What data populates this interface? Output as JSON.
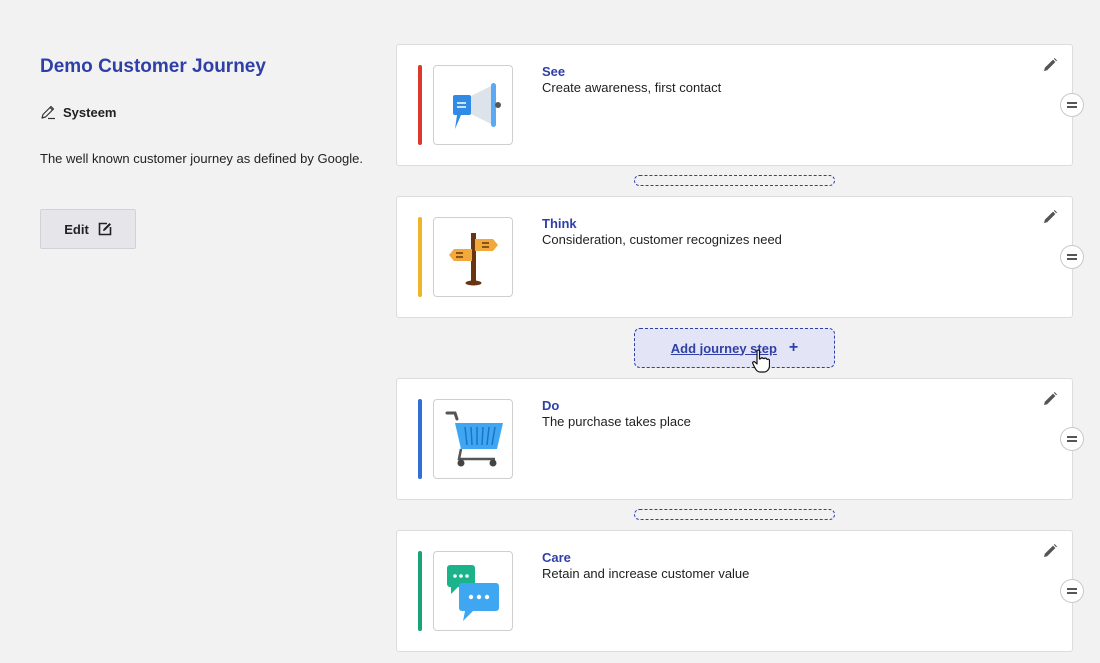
{
  "journey": {
    "title": "Demo Customer Journey",
    "owner": "Systeem",
    "description": "The well known customer journey as defined by Google.",
    "edit_label": "Edit"
  },
  "steps": [
    {
      "name": "See",
      "description": "Create awareness, first contact",
      "color": "#d93a2b",
      "icon": "megaphone-icon"
    },
    {
      "name": "Think",
      "description": "Consideration, customer recognizes need",
      "color": "#f0b429",
      "icon": "signpost-icon"
    },
    {
      "name": "Do",
      "description": "The purchase takes place",
      "color": "#2f6fd6",
      "icon": "shopping-cart-icon"
    },
    {
      "name": "Care",
      "description": "Retain and increase customer value",
      "color": "#1aa37a",
      "icon": "chat-bubbles-icon"
    }
  ],
  "add_step": {
    "label": "Add journey step",
    "icon": "plus-icon"
  },
  "colors": {
    "accent": "#2f3fa8",
    "background": "#f3f2f2"
  }
}
